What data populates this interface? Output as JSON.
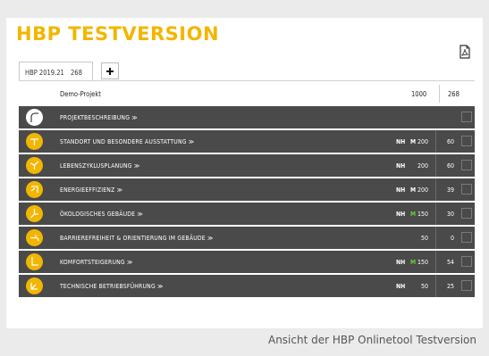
{
  "app": {
    "title": "HBP TESTVERSION",
    "accent_color": "#f2b600",
    "pdf_icon": "pdf-export-icon"
  },
  "tabs": {
    "active": {
      "version": "HBP 2019.21",
      "count": "268"
    },
    "add_icon": "plus-icon"
  },
  "project": {
    "name": "Demo-Projekt",
    "total": "1000",
    "score": "268"
  },
  "sections": [
    {
      "label": "PROJEKTBESCHREIBUNG ≫",
      "nh": "",
      "m": "",
      "m_green": false,
      "max": "",
      "got": "",
      "icon": "white"
    },
    {
      "label": "STANDORT UND BESONDERE AUSSTATTUNG ≫",
      "nh": "NH",
      "m": "M",
      "m_green": false,
      "max": "200",
      "got": "60",
      "icon": "yellow"
    },
    {
      "label": "LEBENSZYKLUSPLANUNG ≫",
      "nh": "NH",
      "m": "",
      "m_green": false,
      "max": "200",
      "got": "60",
      "icon": "yellow"
    },
    {
      "label": "ENERGIEEFFIZIENZ ≫",
      "nh": "NH",
      "m": "M",
      "m_green": false,
      "max": "200",
      "got": "39",
      "icon": "yellow"
    },
    {
      "label": "ÖKOLOGISCHES GEBÄUDE ≫",
      "nh": "NH",
      "m": "M",
      "m_green": true,
      "max": "150",
      "got": "30",
      "icon": "yellow"
    },
    {
      "label": "BARRIEREFREIHEIT & ORIENTIERUNG IM GEBÄUDE ≫",
      "nh": "",
      "m": "",
      "m_green": false,
      "max": "50",
      "got": "0",
      "icon": "yellow"
    },
    {
      "label": "KOMFORTSTEIGERUNG ≫",
      "nh": "NH",
      "m": "M",
      "m_green": true,
      "max": "150",
      "got": "54",
      "icon": "yellow"
    },
    {
      "label": "TECHNISCHE BETRIEBSFÜHRUNG ≫",
      "nh": "NH",
      "m": "",
      "m_green": false,
      "max": "50",
      "got": "25",
      "icon": "yellow"
    }
  ],
  "caption": "Ansicht der HBP Onlinetool Testversion"
}
